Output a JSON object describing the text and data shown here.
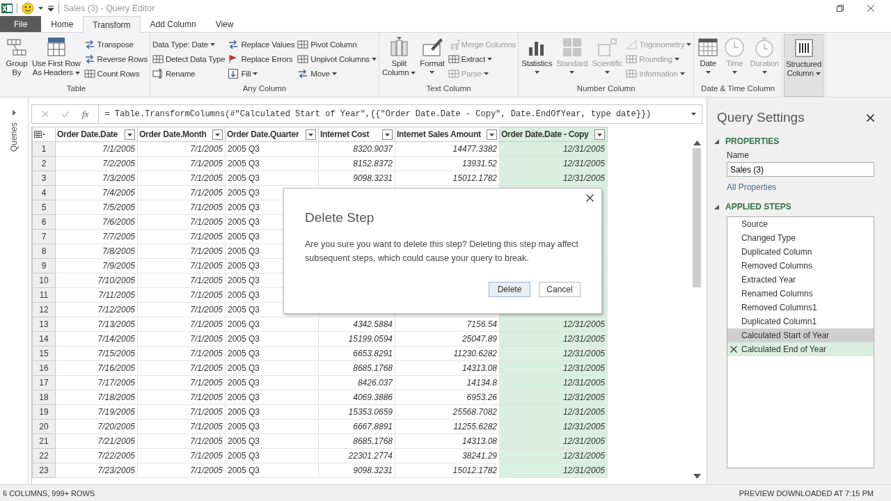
{
  "window": {
    "title": "Sales (3) - Query Editor"
  },
  "tabs": [
    {
      "label": "File",
      "kind": "file",
      "selected": false
    },
    {
      "label": "Home",
      "kind": "tab",
      "selected": false
    },
    {
      "label": "Transform",
      "kind": "tab",
      "selected": true
    },
    {
      "label": "Add Column",
      "kind": "tab",
      "selected": false
    },
    {
      "label": "View",
      "kind": "tab",
      "selected": false
    }
  ],
  "ribbon": {
    "groups": [
      {
        "label": "Table",
        "items": [
          {
            "kind": "large",
            "label": [
              "Group",
              "By"
            ],
            "caret": false,
            "disabled": false
          },
          {
            "kind": "large",
            "label": [
              "Use First Row",
              "As Headers"
            ],
            "caret": true,
            "disabled": false
          },
          {
            "kind": "stack",
            "buttons": [
              {
                "label": "Transpose",
                "caret": false,
                "disabled": false
              },
              {
                "label": "Reverse Rows",
                "caret": false,
                "disabled": false
              },
              {
                "label": "Count Rows",
                "caret": false,
                "disabled": false
              }
            ]
          }
        ]
      },
      {
        "label": "Any Column",
        "items": [
          {
            "kind": "stack",
            "buttons": [
              {
                "label": "Data Type: Date",
                "caret": true,
                "disabled": false
              },
              {
                "label": "Detect Data Type",
                "caret": false,
                "disabled": false
              },
              {
                "label": "Rename",
                "caret": false,
                "disabled": false
              }
            ]
          },
          {
            "kind": "stack",
            "buttons": [
              {
                "label": "Replace Values",
                "caret": false,
                "disabled": false
              },
              {
                "label": "Replace Errors",
                "caret": false,
                "disabled": false
              },
              {
                "label": "Fill",
                "caret": true,
                "disabled": false
              }
            ]
          },
          {
            "kind": "stack",
            "buttons": [
              {
                "label": "Pivot Column",
                "caret": false,
                "disabled": false
              },
              {
                "label": "Unpivot Columns",
                "caret": true,
                "disabled": false
              },
              {
                "label": "Move",
                "caret": true,
                "disabled": false
              }
            ]
          }
        ]
      },
      {
        "label": "Text Column",
        "items": [
          {
            "kind": "large",
            "label": [
              "Split",
              "Column"
            ],
            "caret": true,
            "disabled": false
          },
          {
            "kind": "large",
            "label": [
              "Format"
            ],
            "caret": true,
            "disabled": false
          },
          {
            "kind": "stack",
            "buttons": [
              {
                "label": "Merge Columns",
                "caret": false,
                "disabled": true
              },
              {
                "label": "Extract",
                "caret": true,
                "disabled": false
              },
              {
                "label": "Parse",
                "caret": true,
                "disabled": true
              }
            ]
          }
        ]
      },
      {
        "label": "Number Column",
        "items": [
          {
            "kind": "large",
            "label": [
              "Statistics"
            ],
            "caret": true,
            "disabled": false
          },
          {
            "kind": "large",
            "label": [
              "Standard"
            ],
            "caret": true,
            "disabled": true
          },
          {
            "kind": "large",
            "label": [
              "Scientific"
            ],
            "caret": true,
            "disabled": true
          },
          {
            "kind": "stack",
            "buttons": [
              {
                "label": "Trigonometry",
                "caret": true,
                "disabled": true
              },
              {
                "label": "Rounding",
                "caret": true,
                "disabled": true
              },
              {
                "label": "Information",
                "caret": true,
                "disabled": true
              }
            ]
          }
        ]
      },
      {
        "label": "Date & Time Column",
        "items": [
          {
            "kind": "large",
            "label": [
              "Date"
            ],
            "caret": true,
            "disabled": false
          },
          {
            "kind": "large",
            "label": [
              "Time"
            ],
            "caret": true,
            "disabled": true
          },
          {
            "kind": "large",
            "label": [
              "Duration"
            ],
            "caret": true,
            "disabled": true
          }
        ]
      },
      {
        "items": [
          {
            "kind": "large",
            "label": [
              "Structured",
              "Column"
            ],
            "caret": true,
            "disabled": false,
            "highlighted": true
          }
        ]
      }
    ]
  },
  "queries_pane": {
    "label": "Queries"
  },
  "formula_bar": {
    "fx": "fx",
    "value": "= Table.TransformColumns(#\"Calculated Start of Year\",{{\"Order Date.Date - Copy\", Date.EndOfYear, type date}})"
  },
  "table": {
    "columns": [
      {
        "name": "Order Date.Date",
        "selected": false
      },
      {
        "name": "Order Date.Month",
        "selected": false
      },
      {
        "name": "Order Date.Quarter",
        "selected": false
      },
      {
        "name": "Internet Cost",
        "selected": false
      },
      {
        "name": "Internet Sales Amount",
        "selected": false
      },
      {
        "name": "Order Date.Date - Copy",
        "selected": true
      }
    ],
    "rows": [
      {
        "number": "1",
        "cells": [
          "7/1/2005",
          "7/1/2005",
          "2005 Q3",
          "8320.9037",
          "14477.3382",
          "12/31/2005"
        ]
      },
      {
        "number": "2",
        "cells": [
          "7/2/2005",
          "7/1/2005",
          "2005 Q3",
          "8152.8372",
          "13931.52",
          "12/31/2005"
        ]
      },
      {
        "number": "3",
        "cells": [
          "7/3/2005",
          "7/1/2005",
          "2005 Q3",
          "9098.3231",
          "15012.1782",
          "12/31/2005"
        ]
      },
      {
        "number": "4",
        "cells": [
          "7/4/2005",
          "7/1/2005",
          "2005 Q3"
        ]
      },
      {
        "number": "5",
        "cells": [
          "7/5/2005",
          "7/1/2005",
          "2005 Q3"
        ]
      },
      {
        "number": "6",
        "cells": [
          "7/6/2005",
          "7/1/2005",
          "2005 Q3"
        ]
      },
      {
        "number": "7",
        "cells": [
          "7/7/2005",
          "7/1/2005",
          "2005 Q3"
        ]
      },
      {
        "number": "8",
        "cells": [
          "7/8/2005",
          "7/1/2005",
          "2005 Q3"
        ]
      },
      {
        "number": "9",
        "cells": [
          "7/9/2005",
          "7/1/2005",
          "2005 Q3"
        ]
      },
      {
        "number": "10",
        "cells": [
          "7/10/2005",
          "7/1/2005",
          "2005 Q3"
        ]
      },
      {
        "number": "11",
        "cells": [
          "7/11/2005",
          "7/1/2005",
          "2005 Q3"
        ]
      },
      {
        "number": "12",
        "cells": [
          "7/12/2005",
          "7/1/2005",
          "2005 Q3"
        ]
      },
      {
        "number": "13",
        "cells": [
          "7/13/2005",
          "7/1/2005",
          "2005 Q3",
          "4342.5884",
          "7156.54",
          "12/31/2005"
        ]
      },
      {
        "number": "14",
        "cells": [
          "7/14/2005",
          "7/1/2005",
          "2005 Q3",
          "15199.0594",
          "25047.89",
          "12/31/2005"
        ]
      },
      {
        "number": "15",
        "cells": [
          "7/15/2005",
          "7/1/2005",
          "2005 Q3",
          "6653.8291",
          "11230.6282",
          "12/31/2005"
        ]
      },
      {
        "number": "16",
        "cells": [
          "7/16/2005",
          "7/1/2005",
          "2005 Q3",
          "8685.1768",
          "14313.08",
          "12/31/2005"
        ]
      },
      {
        "number": "17",
        "cells": [
          "7/17/2005",
          "7/1/2005",
          "2005 Q3",
          "8426.037",
          "14134.8",
          "12/31/2005"
        ]
      },
      {
        "number": "18",
        "cells": [
          "7/18/2005",
          "7/1/2005",
          "2005 Q3",
          "4069.3886",
          "6953.26",
          "12/31/2005"
        ]
      },
      {
        "number": "19",
        "cells": [
          "7/19/2005",
          "7/1/2005",
          "2005 Q3",
          "15353.0659",
          "25568.7082",
          "12/31/2005"
        ]
      },
      {
        "number": "20",
        "cells": [
          "7/20/2005",
          "7/1/2005",
          "2005 Q3",
          "6667.8891",
          "11255.6282",
          "12/31/2005"
        ]
      },
      {
        "number": "21",
        "cells": [
          "7/21/2005",
          "7/1/2005",
          "2005 Q3",
          "8685.1768",
          "14313.08",
          "12/31/2005"
        ]
      },
      {
        "number": "22",
        "cells": [
          "7/22/2005",
          "7/1/2005",
          "2005 Q3",
          "22301.2774",
          "38241.29",
          "12/31/2005"
        ]
      },
      {
        "number": "23",
        "cells": [
          "7/23/2005",
          "7/1/2005",
          "2005 Q3",
          "9098.3231",
          "15012.1782",
          "12/31/2005"
        ]
      }
    ]
  },
  "dialog": {
    "title": "Delete Step",
    "message": "Are you sure you want to delete this step? Deleting this step may affect subsequent steps, which could cause your query to break.",
    "buttons": [
      {
        "label": "Delete",
        "hovered": true
      },
      {
        "label": "Cancel",
        "hovered": false
      }
    ]
  },
  "query_settings": {
    "title": "Query Settings",
    "properties": {
      "heading": "PROPERTIES",
      "expanded": true,
      "name_label": "Name",
      "name_value": "Sales (3)",
      "link": "All Properties"
    },
    "applied_steps": {
      "heading": "APPLIED STEPS",
      "expanded": true,
      "steps": [
        {
          "label": "Source",
          "selected": false,
          "hovered": false
        },
        {
          "label": "Changed Type",
          "selected": false,
          "hovered": false
        },
        {
          "label": "Duplicated Column",
          "selected": false,
          "hovered": false
        },
        {
          "label": "Removed Columns",
          "selected": false,
          "hovered": false
        },
        {
          "label": "Extracted Year",
          "selected": false,
          "hovered": false
        },
        {
          "label": "Renamed Columns",
          "selected": false,
          "hovered": false
        },
        {
          "label": "Removed Columns1",
          "selected": false,
          "hovered": false
        },
        {
          "label": "Duplicated Column1",
          "selected": false,
          "hovered": false
        },
        {
          "label": "Calculated Start of Year",
          "selected": true,
          "hovered": false
        },
        {
          "label": "Calculated End of Year",
          "selected": false,
          "hovered": true
        }
      ]
    }
  },
  "status_bar": {
    "left": "6 COLUMNS, 999+ ROWS",
    "right": "PREVIEW DOWNLOADED AT 7:15 PM"
  }
}
